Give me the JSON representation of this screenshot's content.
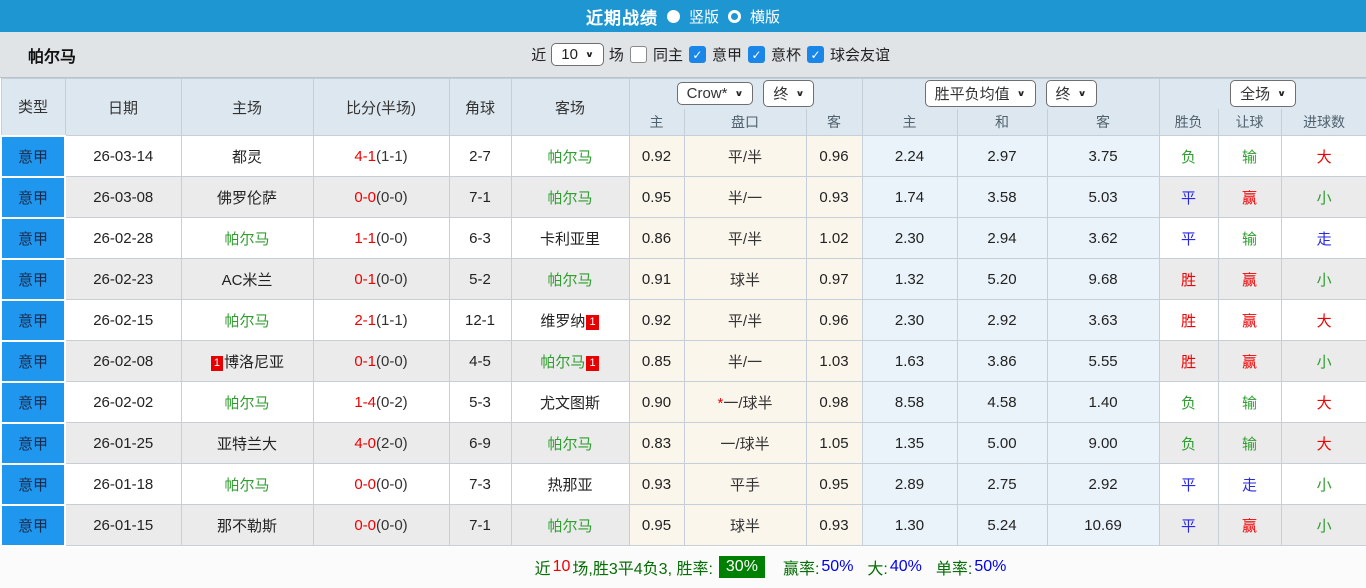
{
  "top_bar": {
    "title": "近期战绩",
    "radios": [
      {
        "label": "竖版",
        "selected": true
      },
      {
        "label": "横版",
        "selected": false
      }
    ]
  },
  "filter_bar": {
    "team_name": "帕尔马",
    "near_label": "近",
    "count_value": "10",
    "count_suffix": "场",
    "checkboxes": [
      {
        "label": "同主",
        "checked": false
      },
      {
        "label": "意甲",
        "checked": true
      },
      {
        "label": "意杯",
        "checked": true
      },
      {
        "label": "球会友谊",
        "checked": true
      }
    ]
  },
  "table": {
    "col_headers": [
      "类型",
      "日期",
      "主场",
      "比分(半场)",
      "角球",
      "客场"
    ],
    "selects": {
      "odds_company": "Crow*",
      "odds_company_time": "终",
      "avg_label": "胜平负均值",
      "avg_time": "终",
      "full_match": "全场"
    },
    "sub_headers": [
      "主",
      "盘口",
      "客",
      "主",
      "和",
      "客"
    ],
    "result_headers": [
      "胜负",
      "让球",
      "进球数"
    ],
    "rows": [
      {
        "type": "意甲",
        "date": "26-03-14",
        "home": {
          "name": "都灵",
          "cls": "",
          "bb": "",
          "ba": ""
        },
        "score": "4-1",
        "half": "(1-1)",
        "corner": "2-7",
        "away": {
          "name": "帕尔马",
          "cls": "tg",
          "bb": "",
          "ba": ""
        },
        "o1": "0.92",
        "star": "",
        "hcp": "平/半",
        "o2": "0.96",
        "a1": "2.24",
        "a2": "2.97",
        "a3": "3.75",
        "r1": {
          "t": "负",
          "c": "cg"
        },
        "r2": {
          "t": "输",
          "c": "cg"
        },
        "r3": {
          "t": "大",
          "c": "cr"
        }
      },
      {
        "type": "意甲",
        "date": "26-03-08",
        "home": {
          "name": "佛罗伦萨",
          "cls": "",
          "bb": "",
          "ba": ""
        },
        "score": "0-0",
        "half": "(0-0)",
        "corner": "7-1",
        "away": {
          "name": "帕尔马",
          "cls": "tg",
          "bb": "",
          "ba": ""
        },
        "o1": "0.95",
        "star": "",
        "hcp": "半/一",
        "o2": "0.93",
        "a1": "1.74",
        "a2": "3.58",
        "a3": "5.03",
        "r1": {
          "t": "平",
          "c": "cb"
        },
        "r2": {
          "t": "赢",
          "c": "cr"
        },
        "r3": {
          "t": "小",
          "c": "cg"
        }
      },
      {
        "type": "意甲",
        "date": "26-02-28",
        "home": {
          "name": "帕尔马",
          "cls": "tg",
          "bb": "",
          "ba": ""
        },
        "score": "1-1",
        "half": "(0-0)",
        "corner": "6-3",
        "away": {
          "name": "卡利亚里",
          "cls": "",
          "bb": "",
          "ba": ""
        },
        "o1": "0.86",
        "star": "",
        "hcp": "平/半",
        "o2": "1.02",
        "a1": "2.30",
        "a2": "2.94",
        "a3": "3.62",
        "r1": {
          "t": "平",
          "c": "cb"
        },
        "r2": {
          "t": "输",
          "c": "cg"
        },
        "r3": {
          "t": "走",
          "c": "cb"
        }
      },
      {
        "type": "意甲",
        "date": "26-02-23",
        "home": {
          "name": "AC米兰",
          "cls": "",
          "bb": "",
          "ba": ""
        },
        "score": "0-1",
        "half": "(0-0)",
        "corner": "5-2",
        "away": {
          "name": "帕尔马",
          "cls": "tg",
          "bb": "",
          "ba": ""
        },
        "o1": "0.91",
        "star": "",
        "hcp": "球半",
        "o2": "0.97",
        "a1": "1.32",
        "a2": "5.20",
        "a3": "9.68",
        "r1": {
          "t": "胜",
          "c": "cr"
        },
        "r2": {
          "t": "赢",
          "c": "cr"
        },
        "r3": {
          "t": "小",
          "c": "cg"
        }
      },
      {
        "type": "意甲",
        "date": "26-02-15",
        "home": {
          "name": "帕尔马",
          "cls": "tg",
          "bb": "",
          "ba": ""
        },
        "score": "2-1",
        "half": "(1-1)",
        "corner": "12-1",
        "away": {
          "name": "维罗纳",
          "cls": "",
          "bb": "",
          "ba": "1"
        },
        "o1": "0.92",
        "star": "",
        "hcp": "平/半",
        "o2": "0.96",
        "a1": "2.30",
        "a2": "2.92",
        "a3": "3.63",
        "r1": {
          "t": "胜",
          "c": "cr"
        },
        "r2": {
          "t": "赢",
          "c": "cr"
        },
        "r3": {
          "t": "大",
          "c": "cr"
        }
      },
      {
        "type": "意甲",
        "date": "26-02-08",
        "home": {
          "name": "博洛尼亚",
          "cls": "",
          "bb": "1",
          "ba": ""
        },
        "score": "0-1",
        "half": "(0-0)",
        "corner": "4-5",
        "away": {
          "name": "帕尔马",
          "cls": "tg",
          "bb": "",
          "ba": "1"
        },
        "o1": "0.85",
        "star": "",
        "hcp": "半/一",
        "o2": "1.03",
        "a1": "1.63",
        "a2": "3.86",
        "a3": "5.55",
        "r1": {
          "t": "胜",
          "c": "cr"
        },
        "r2": {
          "t": "赢",
          "c": "cr"
        },
        "r3": {
          "t": "小",
          "c": "cg"
        }
      },
      {
        "type": "意甲",
        "date": "26-02-02",
        "home": {
          "name": "帕尔马",
          "cls": "tg",
          "bb": "",
          "ba": ""
        },
        "score": "1-4",
        "half": "(0-2)",
        "corner": "5-3",
        "away": {
          "name": "尤文图斯",
          "cls": "",
          "bb": "",
          "ba": ""
        },
        "o1": "0.90",
        "star": "*",
        "hcp": "一/球半",
        "o2": "0.98",
        "a1": "8.58",
        "a2": "4.58",
        "a3": "1.40",
        "r1": {
          "t": "负",
          "c": "cg"
        },
        "r2": {
          "t": "输",
          "c": "cg"
        },
        "r3": {
          "t": "大",
          "c": "cr"
        }
      },
      {
        "type": "意甲",
        "date": "26-01-25",
        "home": {
          "name": "亚特兰大",
          "cls": "",
          "bb": "",
          "ba": ""
        },
        "score": "4-0",
        "half": "(2-0)",
        "corner": "6-9",
        "away": {
          "name": "帕尔马",
          "cls": "tg",
          "bb": "",
          "ba": ""
        },
        "o1": "0.83",
        "star": "",
        "hcp": "一/球半",
        "o2": "1.05",
        "a1": "1.35",
        "a2": "5.00",
        "a3": "9.00",
        "r1": {
          "t": "负",
          "c": "cg"
        },
        "r2": {
          "t": "输",
          "c": "cg"
        },
        "r3": {
          "t": "大",
          "c": "cr"
        }
      },
      {
        "type": "意甲",
        "date": "26-01-18",
        "home": {
          "name": "帕尔马",
          "cls": "tg",
          "bb": "",
          "ba": ""
        },
        "score": "0-0",
        "half": "(0-0)",
        "corner": "7-3",
        "away": {
          "name": "热那亚",
          "cls": "",
          "bb": "",
          "ba": ""
        },
        "o1": "0.93",
        "star": "",
        "hcp": "平手",
        "o2": "0.95",
        "a1": "2.89",
        "a2": "2.75",
        "a3": "2.92",
        "r1": {
          "t": "平",
          "c": "cb"
        },
        "r2": {
          "t": "走",
          "c": "cb"
        },
        "r3": {
          "t": "小",
          "c": "cg"
        }
      },
      {
        "type": "意甲",
        "date": "26-01-15",
        "home": {
          "name": "那不勒斯",
          "cls": "",
          "bb": "",
          "ba": ""
        },
        "score": "0-0",
        "half": "(0-0)",
        "corner": "7-1",
        "away": {
          "name": "帕尔马",
          "cls": "tg",
          "bb": "",
          "ba": ""
        },
        "o1": "0.95",
        "star": "",
        "hcp": "球半",
        "o2": "0.93",
        "a1": "1.30",
        "a2": "5.24",
        "a3": "10.69",
        "r1": {
          "t": "平",
          "c": "cb"
        },
        "r2": {
          "t": "赢",
          "c": "cr"
        },
        "r3": {
          "t": "小",
          "c": "cg"
        }
      }
    ]
  },
  "summary": {
    "prefix": "近",
    "count": "10",
    "middle": "场,胜3平4负3, 胜率:",
    "win_rate": "30%",
    "items": [
      {
        "label": "赢率:",
        "value": "50%"
      },
      {
        "label": "大:",
        "value": "40%"
      },
      {
        "label": "单率:",
        "value": "50%"
      }
    ]
  },
  "colors": {
    "topbar_blue": "#1e96d2",
    "league_cell_blue": "#1f97ee",
    "win_red": "#f00000",
    "draw_blue": "#2828e8",
    "lose_green": "#2f9e2f",
    "rate_badge_green": "#008000",
    "odds_cell_cream": "#fbf6ec",
    "avg_cell_blue": "#e9f3f9"
  }
}
